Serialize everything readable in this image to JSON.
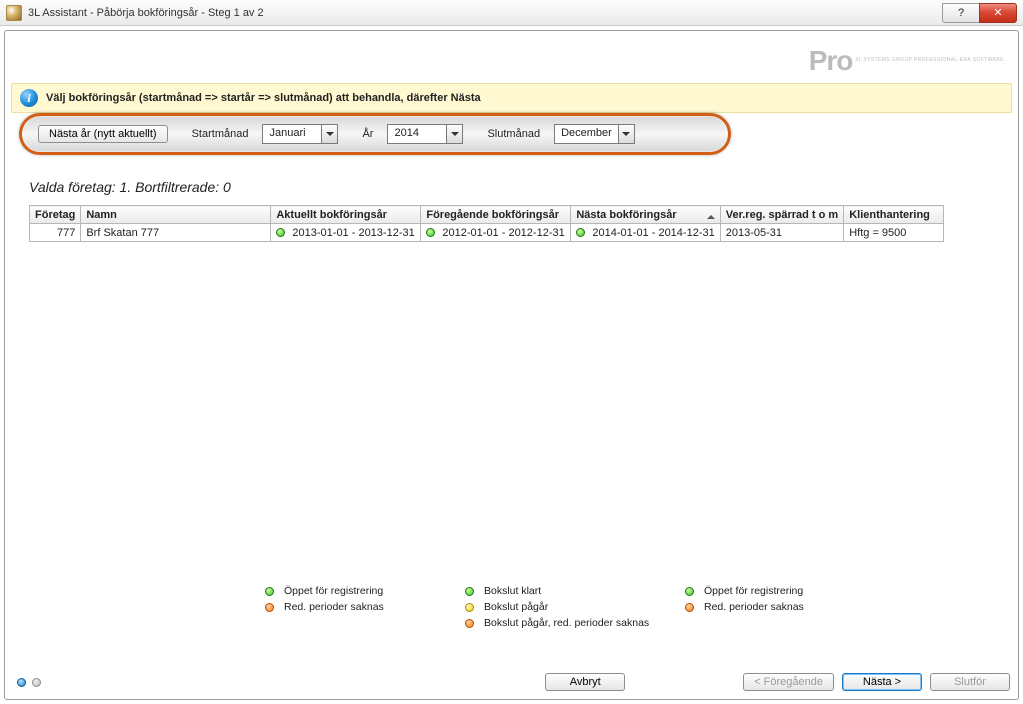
{
  "window": {
    "title": "3L Assistant - Påbörja bokföringsår - Steg 1 av 2",
    "help_glyph": "?",
    "close_glyph": "✕"
  },
  "logo": {
    "main": "Pro",
    "sub": "3L SYSTEMS GROUP\nPROFESSIONAL-ERA SOFTWARE"
  },
  "info": {
    "text": "Välj bokföringsår (startmånad => startår => slutmånad) att behandla, därefter Nästa"
  },
  "params": {
    "next_year_btn": "Nästa år (nytt aktuellt)",
    "start_month_label": "Startmånad",
    "start_month_value": "Januari",
    "year_label": "År",
    "year_value": "2014",
    "end_month_label": "Slutmånad",
    "end_month_value": "December"
  },
  "summary": "Valda företag: 1. Bortfiltrerade: 0",
  "grid": {
    "headers": {
      "foretag": "Företag",
      "namn": "Namn",
      "aktuellt": "Aktuellt bokföringsår",
      "foregaende": "Föregående bokföringsår",
      "nasta": "Nästa bokföringsår",
      "verreg": "Ver.reg. spärrad t o m",
      "klient": "Klienthantering"
    },
    "rows": [
      {
        "foretag": "777",
        "namn": "Brf Skatan 777",
        "aktuellt_dot": "green",
        "aktuellt": "2013-01-01 - 2013-12-31",
        "foregaende_dot": "green",
        "foregaende": "2012-01-01 - 2012-12-31",
        "nasta_dot": "green",
        "nasta": "2014-01-01 - 2014-12-31",
        "verreg": "2013-05-31",
        "klient": "Hftg = 9500"
      }
    ]
  },
  "legend": {
    "c1a": "Öppet för registrering",
    "c1b": "Red. perioder saknas",
    "c2a": "Bokslut klart",
    "c2b": "Bokslut pågår",
    "c2c": "Bokslut pågår, red. perioder saknas",
    "c3a": "Öppet för registrering",
    "c3b": "Red. perioder saknas"
  },
  "footer": {
    "cancel": "Avbryt",
    "prev": "< Föregående",
    "next": "Nästa >",
    "finish": "Slutför"
  }
}
